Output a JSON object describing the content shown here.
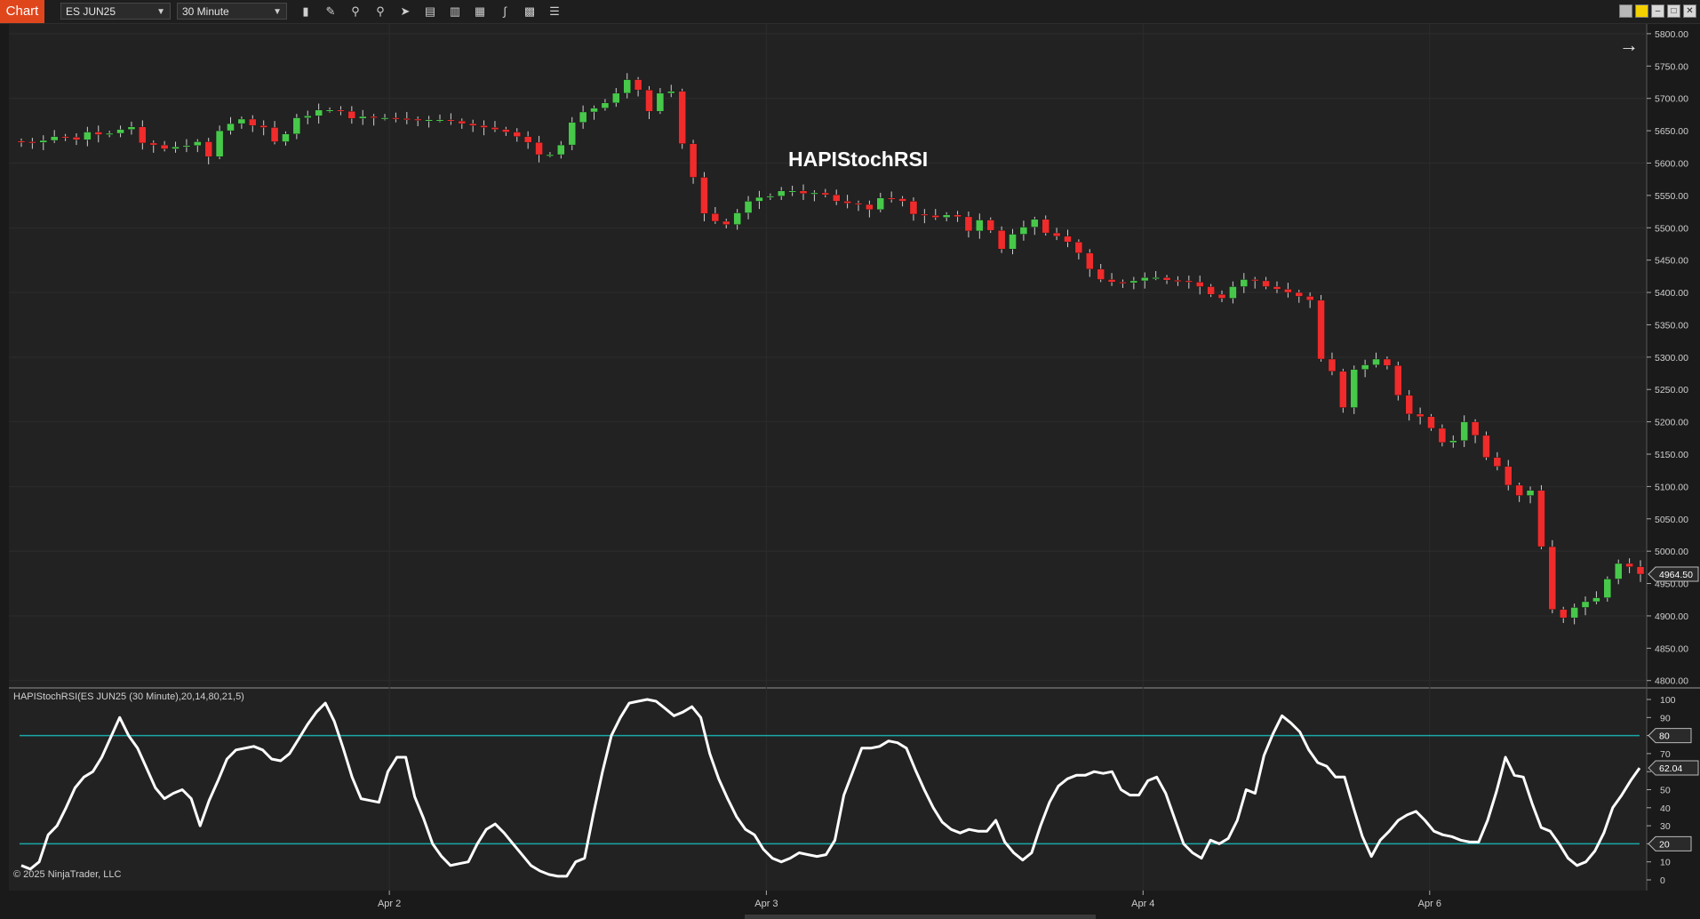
{
  "toolbar": {
    "tab_label": "Chart",
    "instrument": "ES JUN25",
    "interval": "30 Minute",
    "tools": [
      "bar-type-icon",
      "pencil-icon",
      "zoom-in-icon",
      "zoom-out-icon",
      "pointer-icon",
      "data-box-icon",
      "properties-icon",
      "strategies-icon",
      "indicators-icon",
      "list-icon"
    ]
  },
  "colors": {
    "background": "#222222",
    "up_candle": "#47c84a",
    "down_candle": "#ef2b2b",
    "wick": "#d0d0d0",
    "indicator_line": "#ffffff",
    "level_line": "#1aa7a7",
    "axis_text": "#cfcfcf",
    "grid": "#2c2c2c",
    "tab": "#e0461c"
  },
  "chart_data": [
    {
      "type": "candlestick",
      "title": "HAPIStochRSI",
      "x_ticks": [
        "Apr 2",
        "Apr 3",
        "Apr 4",
        "Apr 6"
      ],
      "y_ticks": [
        "5800.00",
        "5750.00",
        "5700.00",
        "5650.00",
        "5600.00",
        "5550.00",
        "5500.00",
        "5450.00",
        "5400.00",
        "5350.00",
        "5300.00",
        "5250.00",
        "5200.00",
        "5150.00",
        "5100.00",
        "5050.00",
        "5000.00",
        "4950.00",
        "4900.00",
        "4850.00",
        "4800.00"
      ],
      "ylim": [
        4790,
        5815
      ],
      "last_price": "4964.50",
      "close_series": [
        5633,
        5632,
        5635,
        5641,
        5640,
        5636,
        5648,
        5644,
        5646,
        5652,
        5656,
        5631,
        5628,
        5622,
        5625,
        5627,
        5633,
        5610,
        5650,
        5661,
        5668,
        5658,
        5655,
        5633,
        5645,
        5670,
        5673,
        5682,
        5682,
        5680,
        5669,
        5672,
        5670,
        5670,
        5669,
        5668,
        5667,
        5667,
        5667,
        5665,
        5661,
        5658,
        5655,
        5652,
        5648,
        5641,
        5632,
        5613,
        5613,
        5628,
        5663,
        5679,
        5685,
        5693,
        5708,
        5729,
        5713,
        5680,
        5708,
        5711,
        5630,
        5578,
        5522,
        5510,
        5505,
        5523,
        5541,
        5547,
        5549,
        5557,
        5557,
        5553,
        5554,
        5551,
        5541,
        5538,
        5536,
        5528,
        5546,
        5545,
        5541,
        5521,
        5519,
        5516,
        5520,
        5517,
        5495,
        5512,
        5496,
        5467,
        5490,
        5501,
        5513,
        5492,
        5487,
        5478,
        5461,
        5436,
        5420,
        5416,
        5415,
        5418,
        5423,
        5423,
        5419,
        5418,
        5416,
        5409,
        5397,
        5391,
        5409,
        5420,
        5418,
        5409,
        5405,
        5400,
        5394,
        5388,
        5297,
        5278,
        5222,
        5281,
        5288,
        5297,
        5287,
        5241,
        5212,
        5208,
        5190,
        5168,
        5171,
        5200,
        5179,
        5145,
        5131,
        5102,
        5086,
        5094,
        5007,
        4910,
        4897,
        4913,
        4922,
        4928,
        4957,
        4981,
        4976,
        4964.5
      ]
    },
    {
      "type": "line",
      "series_name": "HAPIStochRSI(ES JUN25 (30 Minute),20,14,80,21,5)",
      "y_ticks": [
        "100",
        "90",
        "80",
        "70",
        "60",
        "50",
        "40",
        "30",
        "20",
        "10",
        "0"
      ],
      "ylim": [
        0,
        100
      ],
      "levels": [
        20,
        80
      ],
      "level_labels": [
        "80",
        "20"
      ],
      "last_value": "62.04",
      "values": [
        8,
        6,
        10,
        25,
        30,
        40,
        51,
        57,
        60,
        68,
        79,
        90,
        80,
        73,
        62,
        51,
        45,
        48,
        50,
        45,
        30,
        44,
        55,
        67,
        72,
        73,
        74,
        72,
        67,
        66,
        70,
        78,
        86,
        93,
        98,
        88,
        73,
        57,
        45,
        44,
        43,
        60,
        68,
        68,
        46,
        34,
        20,
        13,
        8,
        9,
        10,
        20,
        28,
        31,
        26,
        20,
        14,
        8,
        5,
        3,
        2,
        2,
        10,
        12,
        37,
        60,
        80,
        90,
        98,
        99,
        100,
        99,
        95,
        91,
        93,
        96,
        90,
        70,
        56,
        45,
        35,
        28,
        25,
        17,
        12,
        10,
        12,
        15,
        14,
        13,
        14,
        22,
        47,
        60,
        73,
        73,
        74,
        77,
        76,
        73,
        61,
        50,
        40,
        32,
        28,
        26,
        28,
        27,
        27,
        33,
        21,
        15,
        11,
        15,
        30,
        43,
        52,
        56,
        58,
        58,
        60,
        59,
        60,
        50,
        47,
        47,
        55,
        57,
        48,
        34,
        20,
        15,
        12,
        22,
        20,
        23,
        33,
        50,
        48,
        69,
        81,
        91,
        87,
        82,
        72,
        65,
        63,
        57,
        57,
        40,
        24,
        13,
        22,
        27,
        33,
        36,
        38,
        33,
        27,
        25,
        24,
        22,
        21,
        21,
        33,
        49,
        68,
        58,
        57,
        42,
        29,
        27,
        20,
        12,
        8,
        10,
        16,
        26,
        40,
        47,
        55,
        62.04
      ],
      "watermark": "© 2025 NinjaTrader, LLC"
    }
  ]
}
